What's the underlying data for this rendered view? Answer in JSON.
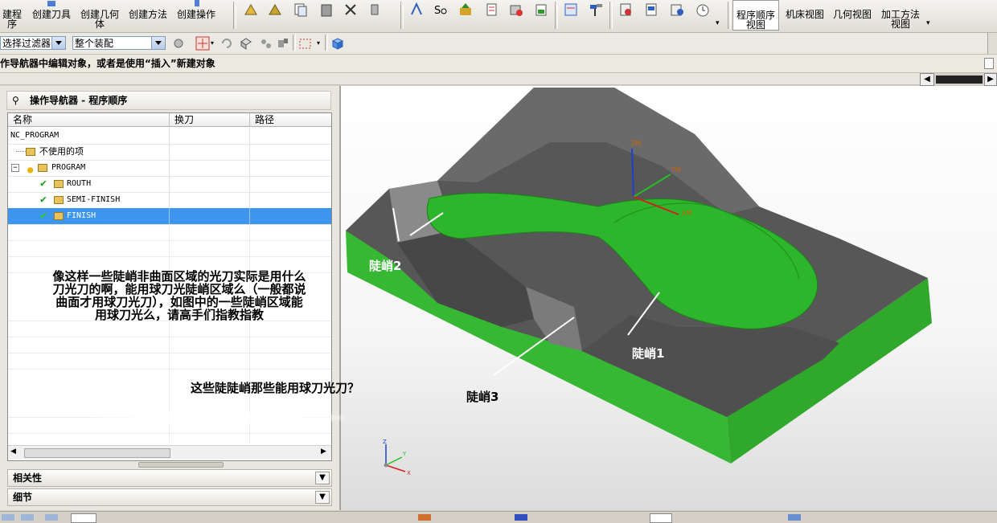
{
  "toolbar1": {
    "create_program": "建程序",
    "create_tool": "创建刀具",
    "create_geometry": "创建几何体",
    "create_method": "创建方法",
    "create_operation": "创建操作",
    "view_program_order": "程序顺序视图",
    "view_machine": "机床视图",
    "view_geometry": "几何视图",
    "view_method": "加工方法视图"
  },
  "toolbar2": {
    "filter_value": "选择过滤器",
    "assembly_value": "整个装配"
  },
  "status": {
    "text": "作导航器中编辑对象，或者是使用“插入”新建对象"
  },
  "navigator": {
    "title": "操作导航器 - 程序顺序",
    "columns": [
      "名称",
      "换刀",
      "路径"
    ],
    "rows": [
      {
        "name": "NC_PROGRAM"
      },
      {
        "name": "不使用的项"
      },
      {
        "name": "PROGRAM"
      },
      {
        "name": "ROUTH"
      },
      {
        "name": "SEMI-FINISH"
      },
      {
        "name": "FINISH"
      }
    ],
    "accordion": [
      "相关性",
      "细节"
    ]
  },
  "annotations": {
    "question_line1": "像这样一些陡峭非曲面区域的光刀实际是用什么",
    "question_line2": "刀光刀的啊，能用球刀光陡峭区域么（一般都说",
    "question_line3": "曲面才用球刀光刀），如图中的一些陡峭区域能",
    "question_line4": "用球刀光么，请高手们指教指教",
    "question2": "这些陡陡峭那些能用球刀光刀？"
  },
  "viewport": {
    "label_steep1": "陡峭1",
    "label_steep2": "陡峭2",
    "label_steep3": "陡峭3",
    "wcs": {
      "zm": "ZM",
      "ym": "YM",
      "xm": "XM"
    },
    "triad": {
      "z": "Z",
      "y": "Y",
      "x": "X"
    },
    "colors": {
      "part_green": "#2db52b",
      "stock_gray": "#5a5a5a",
      "selection": "#3d95ee"
    }
  }
}
